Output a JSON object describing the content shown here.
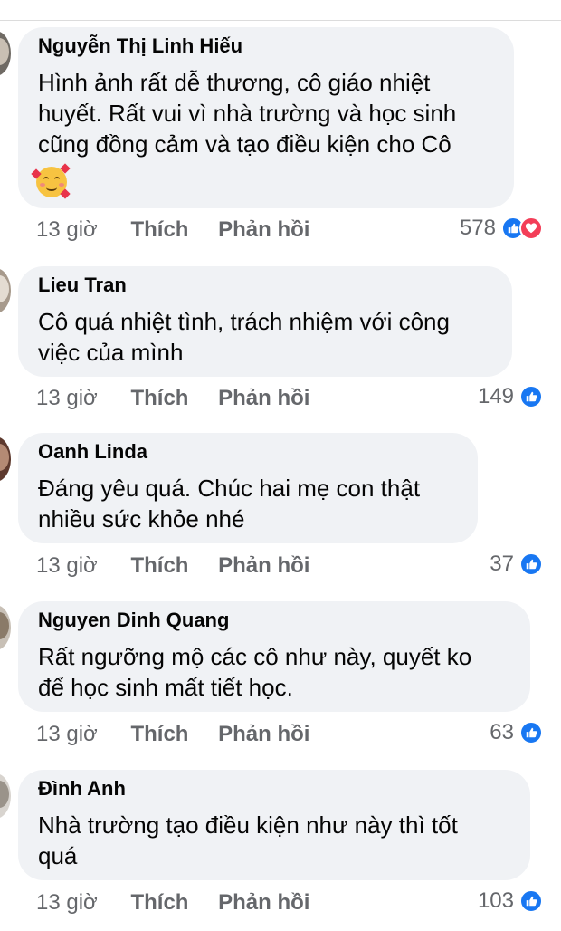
{
  "comments": [
    {
      "author": "Nguyễn Thị Linh Hiếu",
      "text": "Hình ảnh rất dễ thương, cô giáo nhiệt\nhuyết. Rất vui vì nhà trường và học sinh\ncũng đồng cảm và tạo điều kiện cho Cô",
      "emoji": "smiling-face-with-hearts-emoji",
      "time": "13 giờ",
      "like_label": "Thích",
      "reply_label": "Phản hồi",
      "reaction_count": "578",
      "reactions": [
        "like-icon",
        "love-icon"
      ]
    },
    {
      "author": "Lieu Tran",
      "text": "Cô quá nhiệt tình, trách nhiệm với công\nviệc của mình",
      "time": "13 giờ",
      "like_label": "Thích",
      "reply_label": "Phản hồi",
      "reaction_count": "149",
      "reactions": [
        "like-icon"
      ]
    },
    {
      "author": "Oanh Linda",
      "text": "Đáng yêu quá. Chúc hai mẹ con thật\nnhiều sức khỏe nhé",
      "time": "13 giờ",
      "like_label": "Thích",
      "reply_label": "Phản hồi",
      "reaction_count": "37",
      "reactions": [
        "like-icon"
      ]
    },
    {
      "author": "Nguyen Dinh Quang",
      "text": "Rất ngưỡng mộ các cô như này, quyết ko\nđể học sinh mất tiết học.",
      "time": "13 giờ",
      "like_label": "Thích",
      "reply_label": "Phản hồi",
      "reaction_count": "63",
      "reactions": [
        "like-icon"
      ]
    },
    {
      "author": "Đình Anh",
      "text": "Nhà trường tạo điều kiện như này thì tốt\nquá",
      "time": "13 giờ",
      "like_label": "Thích",
      "reply_label": "Phản hồi",
      "reaction_count": "103",
      "reactions": [
        "like-icon"
      ]
    }
  ],
  "colors": {
    "bubble": "#f0f2f5",
    "muted_text": "#65676b",
    "like_blue": "#1877f2",
    "love_red": "#f33e58"
  }
}
